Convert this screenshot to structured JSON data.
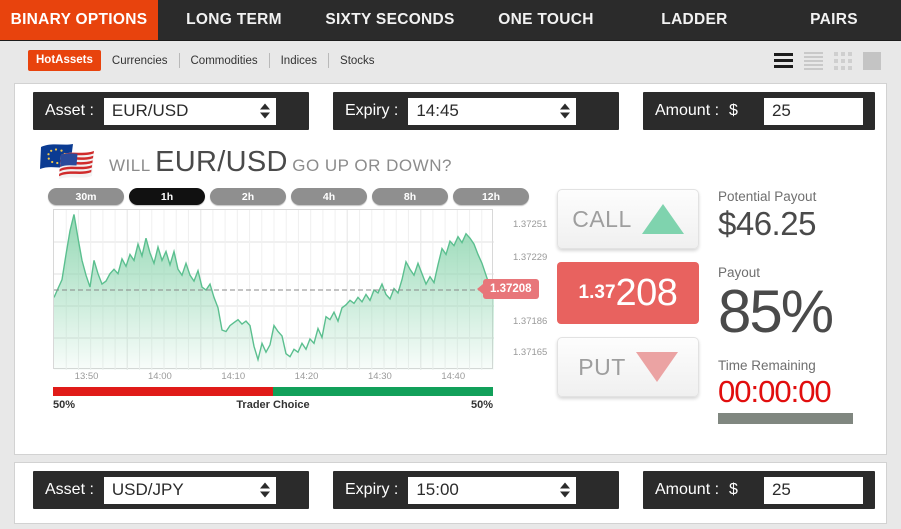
{
  "topnav": {
    "items": [
      {
        "label": "BINARY OPTIONS",
        "active": true
      },
      {
        "label": "LONG TERM",
        "active": false
      },
      {
        "label": "SIXTY SECONDS",
        "active": false
      },
      {
        "label": "ONE TOUCH",
        "active": false
      },
      {
        "label": "LADDER",
        "active": false
      },
      {
        "label": "PAIRS",
        "active": false
      }
    ],
    "active_color": "#e8430d",
    "bg_color": "#2b2b2b"
  },
  "subnav": {
    "chip": "HotAssets",
    "links": [
      "Currencies",
      "Commodities",
      "Indices",
      "Stocks"
    ],
    "view_icons": [
      "list-thick-icon",
      "list-thin-icon",
      "grid-dots-icon",
      "solid-square-icon"
    ]
  },
  "trade_top": {
    "asset": {
      "label": "Asset :",
      "value": "EUR/USD"
    },
    "expiry": {
      "label": "Expiry :",
      "value": "14:45"
    },
    "amount": {
      "label": "Amount :",
      "currency": "$",
      "value": "25"
    },
    "headline": {
      "prefix": "WILL",
      "asset": "EUR/USD",
      "suffix": "GO UP OR DOWN?"
    },
    "timeframes": [
      {
        "label": "30m",
        "active": false
      },
      {
        "label": "1h",
        "active": true
      },
      {
        "label": "2h",
        "active": false
      },
      {
        "label": "4h",
        "active": false
      },
      {
        "label": "8h",
        "active": false
      },
      {
        "label": "12h",
        "active": false
      }
    ],
    "call": {
      "label": "CALL",
      "icon": "triangle-up-icon",
      "color": "#7fd3ae"
    },
    "put": {
      "label": "PUT",
      "icon": "triangle-down-icon",
      "color": "#eba3a3"
    },
    "price": {
      "prefix": "1.37",
      "main": "208",
      "box_color": "#e8625f"
    },
    "payout": {
      "potential_label": "Potential Payout",
      "potential_value": "$46.25",
      "payout_label": "Payout",
      "payout_value": "85%",
      "time_label": "Time Remaining",
      "time_value": "00:00:00",
      "time_color": "#e10e0e",
      "progress_pct": 100
    },
    "trader_choice": {
      "label": "Trader Choice",
      "left_pct": "50%",
      "right_pct": "50%",
      "call_share": 50,
      "put_share": 50,
      "red_color": "#e01b18",
      "green_color": "#12a05a"
    }
  },
  "trade_bottom": {
    "asset": {
      "label": "Asset :",
      "value": "USD/JPY"
    },
    "expiry": {
      "label": "Expiry :",
      "value": "15:00"
    },
    "amount": {
      "label": "Amount :",
      "currency": "$",
      "value": "25"
    }
  },
  "chart_data": {
    "type": "area",
    "title": "",
    "xlabel": "",
    "ylabel": "",
    "x_tick_labels": [
      "13:50",
      "14:00",
      "14:10",
      "14:20",
      "14:30",
      "14:40"
    ],
    "y_tick_labels": [
      "1.37251",
      "1.37229",
      "1.37208",
      "1.37186",
      "1.37165"
    ],
    "ylim": [
      1.37154,
      1.37262
    ],
    "current_price": "1.37208",
    "current_price_label": "1.37208",
    "grid": true,
    "legend": "none",
    "line_color": "#5bbf8f",
    "fill_color": "#8ed6b0",
    "marker_color": "#e8767a",
    "values": [
      1.37203,
      1.37209,
      1.37215,
      1.37232,
      1.37248,
      1.37259,
      1.37243,
      1.37228,
      1.37218,
      1.3721,
      1.37228,
      1.37219,
      1.37212,
      1.37214,
      1.37219,
      1.37222,
      1.37219,
      1.37229,
      1.37224,
      1.37232,
      1.37228,
      1.37239,
      1.37231,
      1.37243,
      1.37233,
      1.37226,
      1.37237,
      1.37228,
      1.37234,
      1.37225,
      1.37234,
      1.37222,
      1.37218,
      1.37226,
      1.37218,
      1.37214,
      1.37221,
      1.3721,
      1.37208,
      1.37212,
      1.37203,
      1.37196,
      1.37181,
      1.3718,
      1.37184,
      1.37186,
      1.37188,
      1.37185,
      1.37187,
      1.37184,
      1.3717,
      1.37161,
      1.37172,
      1.37166,
      1.37171,
      1.37184,
      1.3718,
      1.37177,
      1.37165,
      1.37163,
      1.37168,
      1.37166,
      1.37172,
      1.37168,
      1.37175,
      1.37172,
      1.37182,
      1.37176,
      1.3719,
      1.37188,
      1.37193,
      1.37187,
      1.37196,
      1.37198,
      1.37201,
      1.37199,
      1.37203,
      1.372,
      1.37205,
      1.37201,
      1.37208,
      1.37206,
      1.37212,
      1.37205,
      1.37202,
      1.37209,
      1.37206,
      1.37215,
      1.37227,
      1.37222,
      1.37218,
      1.37226,
      1.37219,
      1.37212,
      1.37217,
      1.37213,
      1.37225,
      1.37236,
      1.37232,
      1.37241,
      1.37238,
      1.37244,
      1.3724,
      1.37246,
      1.37243,
      1.37239,
      1.37232,
      1.37226,
      1.37218,
      1.3721,
      1.37208
    ]
  }
}
